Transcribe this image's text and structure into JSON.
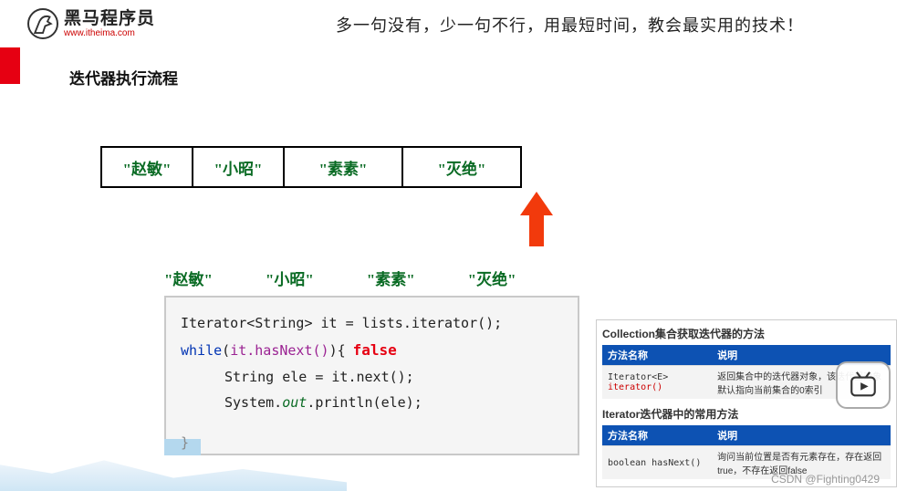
{
  "header": {
    "logo_main": "黑马程序员",
    "logo_url": "www.itheima.com",
    "tagline": "多一句没有，少一句不行，用最短时间，教会最实用的技术！"
  },
  "section_title": "迭代器执行流程",
  "array_cells": [
    "\"赵敏\"",
    "\"小昭\"",
    "\"素素\"",
    "\"灭绝\""
  ],
  "iter_outputs": [
    "\"赵敏\"",
    "\"小昭\"",
    "\"素素\"",
    "\"灭绝\""
  ],
  "code": {
    "line1_a": "Iterator<String> it = lists.",
    "line1_b": "iterator",
    "line1_c": "();",
    "line2_a": "while",
    "line2_b": "(",
    "line2_c": "it.hasNext()",
    "line2_d": "){",
    "line2_false": "false",
    "line3": "String ele = it.next();",
    "line4_a": "System.",
    "line4_b": "out",
    "line4_c": ".println(ele);",
    "brace_end": "}"
  },
  "side": {
    "title1": "Collection集合获取迭代器的方法",
    "th_method": "方法名称",
    "th_desc": "说明",
    "row1_method_a": "Iterator<E> ",
    "row1_method_b": "iterator()",
    "row1_desc": "返回集合中的迭代器对象，该迭代器对象默认指向当前集合的0索引",
    "title2": "Iterator迭代器中的常用方法",
    "row2_method": "boolean hasNext()",
    "row2_desc": "询问当前位置是否有元素存在，存在返回true，不存在返回false"
  },
  "watermark": "CSDN @Fighting0429"
}
